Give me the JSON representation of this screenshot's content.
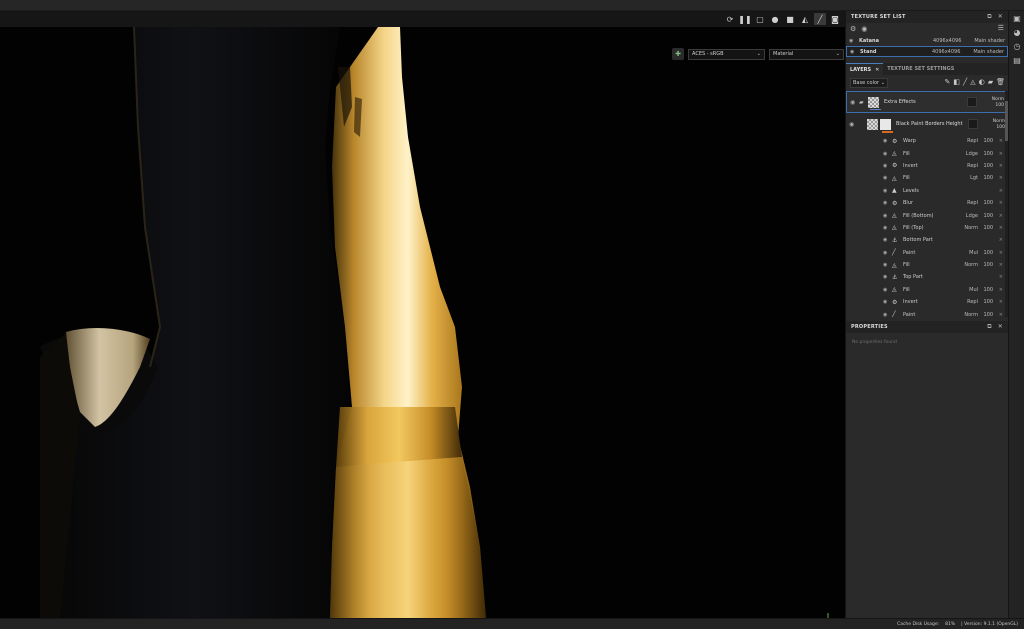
{
  "viewport": {
    "tools": [
      {
        "name": "camera-reset-icon",
        "glyph": "⟳"
      },
      {
        "name": "pause-icon",
        "glyph": "❚❚"
      },
      {
        "name": "selection-icon",
        "glyph": "▢"
      },
      {
        "name": "sphere-icon",
        "glyph": "●"
      },
      {
        "name": "video-camera-icon",
        "glyph": "■"
      },
      {
        "name": "projection-icon",
        "glyph": "◭"
      },
      {
        "name": "brush-icon",
        "glyph": "╱"
      },
      {
        "name": "render-icon",
        "glyph": "◙"
      }
    ],
    "color_space": "ACES - sRGB",
    "view_mode": "Material"
  },
  "texture_set_list": {
    "title": "TEXTURE SET LIST",
    "rows": [
      {
        "name": "Katana",
        "resolution": "4096x4096",
        "shader": "Main shader",
        "selected": false
      },
      {
        "name": "Stand",
        "resolution": "4096x4096",
        "shader": "Main shader",
        "selected": true
      }
    ]
  },
  "tabs": {
    "layers": "LAYERS",
    "texture_set_settings": "TEXTURE SET SETTINGS"
  },
  "layers": {
    "channel": "Base color",
    "groups": [
      {
        "name": "Extra Effects",
        "blend": "Norm",
        "opacity": "100"
      },
      {
        "name": "Black Paint Borders Height",
        "blend": "Norm",
        "opacity": "100"
      }
    ],
    "effects": [
      {
        "name": "Warp",
        "icon": "⚙",
        "blend": "Repl",
        "opacity": "100"
      },
      {
        "name": "Fill",
        "icon": "◬",
        "blend": "Ldge",
        "opacity": "100"
      },
      {
        "name": "Invert",
        "icon": "⚙",
        "blend": "Repl",
        "opacity": "100"
      },
      {
        "name": "Fill",
        "icon": "◬",
        "blend": "Lgt",
        "opacity": "100"
      },
      {
        "name": "Levels",
        "icon": "▲",
        "blend": "",
        "opacity": ""
      },
      {
        "name": "Blur",
        "icon": "⚙",
        "blend": "Repl",
        "opacity": "100"
      },
      {
        "name": "Fill (Bottom)",
        "icon": "◬",
        "blend": "Ldge",
        "opacity": "100"
      },
      {
        "name": "Fill (Top)",
        "icon": "◬",
        "blend": "Norm",
        "opacity": "100"
      },
      {
        "name": "Bottom Part",
        "icon": "⚓",
        "blend": "",
        "opacity": ""
      },
      {
        "name": "Paint",
        "icon": "╱",
        "blend": "Mul",
        "opacity": "100"
      },
      {
        "name": "Fill",
        "icon": "◬",
        "blend": "Norm",
        "opacity": "100"
      },
      {
        "name": "Top Part",
        "icon": "⚓",
        "blend": "",
        "opacity": ""
      },
      {
        "name": "Fill",
        "icon": "◬",
        "blend": "Mul",
        "opacity": "100"
      },
      {
        "name": "Invert",
        "icon": "⚙",
        "blend": "Repl",
        "opacity": "100"
      },
      {
        "name": "Paint",
        "icon": "╱",
        "blend": "Norm",
        "opacity": "100"
      }
    ]
  },
  "properties": {
    "title": "PROPERTIES",
    "empty": "No properties found"
  },
  "status": {
    "cache": "Cache Disk Usage:",
    "cache_value": "81%",
    "version": "| Version: 9.1.1 (OpenGL)"
  }
}
